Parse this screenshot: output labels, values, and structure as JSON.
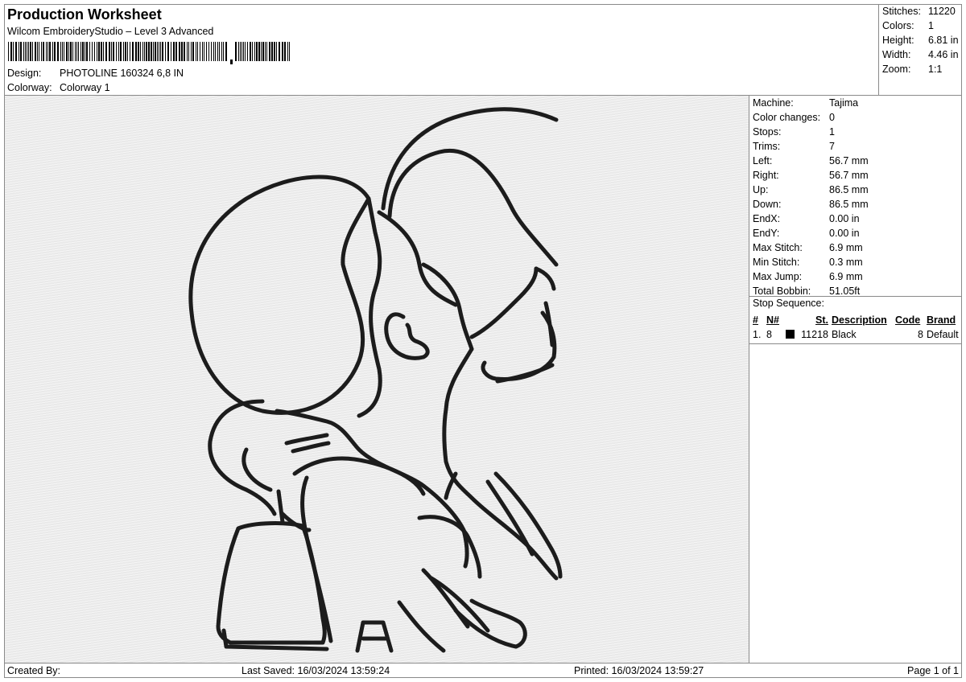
{
  "header": {
    "title": "Production Worksheet",
    "software": "Wilcom EmbroideryStudio – Level 3 Advanced",
    "design_label": "Design:",
    "design_value": "PHOTOLINE 160324 6,8 IN",
    "colorway_label": "Colorway:",
    "colorway_value": "Colorway 1"
  },
  "summary": {
    "stitches_label": "Stitches:",
    "stitches_value": "11220",
    "colors_label": "Colors:",
    "colors_value": "1",
    "height_label": "Height:",
    "height_value": "6.81 in",
    "width_label": "Width:",
    "width_value": "4.46 in",
    "zoom_label": "Zoom:",
    "zoom_value": "1:1"
  },
  "details": [
    {
      "label": "Machine:",
      "value": "Tajima"
    },
    {
      "label": "Color changes:",
      "value": "0"
    },
    {
      "label": "Stops:",
      "value": "1"
    },
    {
      "label": "Trims:",
      "value": "7"
    },
    {
      "label": "Left:",
      "value": "56.7 mm"
    },
    {
      "label": "Right:",
      "value": "56.7 mm"
    },
    {
      "label": "Up:",
      "value": "86.5 mm"
    },
    {
      "label": "Down:",
      "value": "86.5 mm"
    },
    {
      "label": "EndX:",
      "value": "0.00 in"
    },
    {
      "label": "EndY:",
      "value": "0.00 in"
    },
    {
      "label": "Max Stitch:",
      "value": "6.9 mm"
    },
    {
      "label": "Min Stitch:",
      "value": "0.3 mm"
    },
    {
      "label": "Max Jump:",
      "value": "6.9 mm"
    },
    {
      "label": "Total Bobbin:",
      "value": "51.05ft"
    }
  ],
  "stop_sequence": {
    "title": "Stop Sequence:",
    "columns": {
      "num": "#",
      "needle": "N#",
      "stitches": "St.",
      "description": "Description",
      "code": "Code",
      "brand": "Brand"
    },
    "rows": [
      {
        "num": "1.",
        "needle": "8",
        "swatch_color": "#000000",
        "stitches": "11218",
        "description": "Black",
        "code": "8",
        "brand": "Default"
      }
    ]
  },
  "footer": {
    "created_by": "Created By:",
    "last_saved": "Last Saved: 16/03/2024 13:59:24",
    "printed": "Printed: 16/03/2024 13:59:27",
    "page": "Page 1 of 1"
  },
  "design_preview": {
    "background_color": "#e9e9e9",
    "stitch_color": "#1c1c1c"
  }
}
